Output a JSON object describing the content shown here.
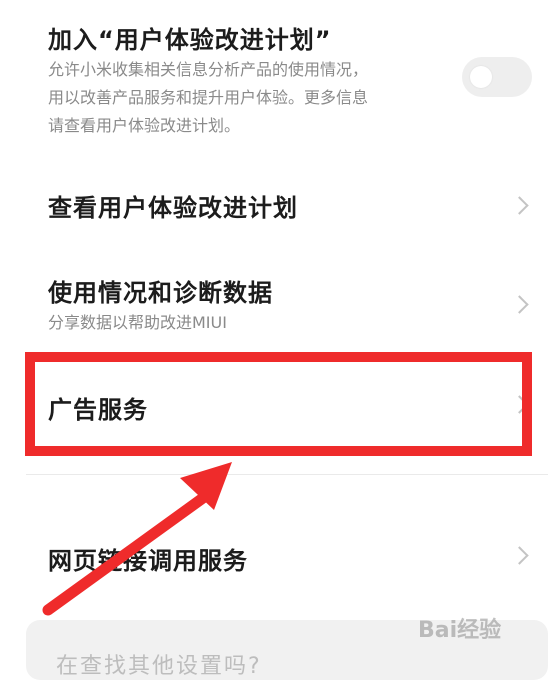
{
  "ux_plan": {
    "title": "加入“用户体验改进计划”",
    "description_lines": [
      "允许小米收集相关信息分析产品的使用情况，",
      "用以改善产品服务和提升用户体验。更多信息",
      "请查看用户体验改进计划。"
    ],
    "toggle_state": "off"
  },
  "rows": [
    {
      "title": "查看用户体验改进计划",
      "icon": "chevron-right-icon"
    },
    {
      "title": "使用情况和诊断数据",
      "subtitle": "分享数据以帮助改进MIUI",
      "icon": "chevron-right-icon"
    },
    {
      "title": "广告服务",
      "icon": "chevron-right-icon"
    },
    {
      "title": "网页链接调用服务",
      "icon": "chevron-right-icon"
    }
  ],
  "bottom_card": {
    "text": "在查找其他设置吗?"
  },
  "annotation": {
    "highlight_color": "#ef2b2b"
  },
  "watermark": {
    "text": "Bai经验"
  }
}
